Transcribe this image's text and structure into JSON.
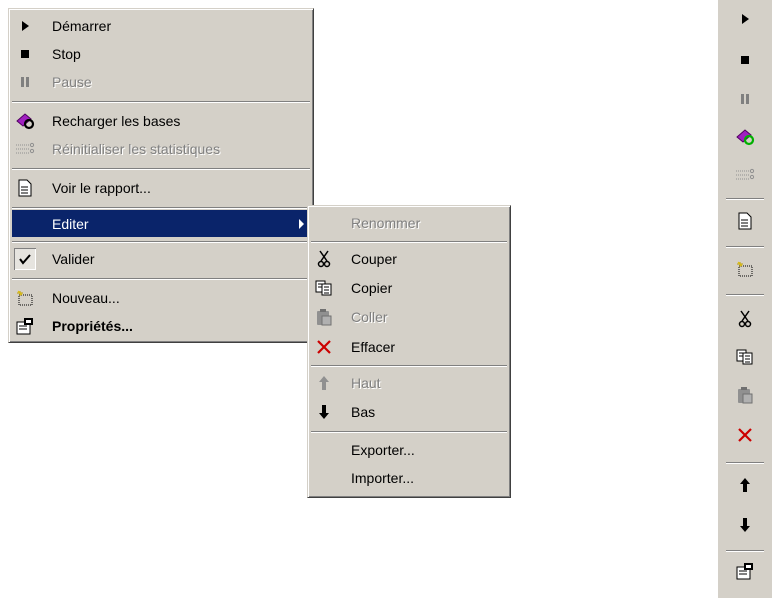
{
  "context_menu": {
    "items": {
      "start": "Démarrer",
      "stop": "Stop",
      "pause": "Pause",
      "reload": "Recharger les bases",
      "reset_stats": "Réinitialiser les statistiques",
      "view_report": "Voir le rapport...",
      "edit": "Editer",
      "validate": "Valider",
      "new": "Nouveau...",
      "properties": "Propriétés..."
    }
  },
  "edit_submenu": {
    "items": {
      "rename": "Renommer",
      "cut": "Couper",
      "copy": "Copier",
      "paste": "Coller",
      "delete": "Effacer",
      "up": "Haut",
      "down": "Bas",
      "export": "Exporter...",
      "import": "Importer..."
    }
  },
  "colors": {
    "menu_bg": "#d4d0c8",
    "selection": "#0a246a",
    "disabled_text": "#808080",
    "delete_red": "#cc0000",
    "reload_purple": "#a020c0",
    "reload_green": "#00b000"
  },
  "toolbar": {
    "icons": [
      "play-icon",
      "stop-icon",
      "pause-icon",
      "reload-icon",
      "reset-stats-icon",
      "report-icon",
      "new-icon",
      "cut-icon",
      "copy-icon",
      "paste-icon",
      "delete-icon",
      "arrow-up-icon",
      "arrow-down-icon",
      "properties-icon"
    ]
  }
}
